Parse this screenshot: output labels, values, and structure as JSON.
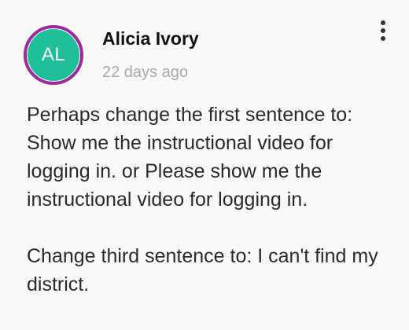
{
  "comment": {
    "avatar": {
      "initials": "AL",
      "fill_color": "#1fbf9a",
      "ring_color": "#9c2a9e"
    },
    "author": "Alicia Ivory",
    "timestamp": "22 days ago",
    "menu_icon": "more-vertical-icon",
    "paragraphs": [
      "Perhaps change the first sentence to: Show me the instructional video for logging in. or Please show me the instructional video for logging in.",
      "Change third sentence to: I can't find my district."
    ]
  }
}
